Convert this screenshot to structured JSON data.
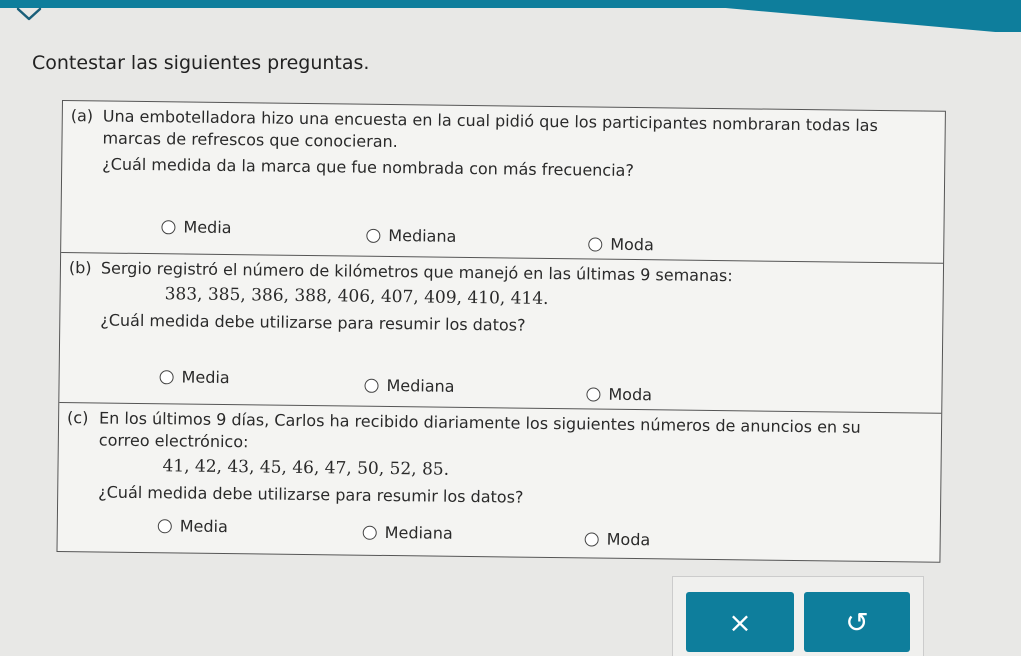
{
  "header": {
    "title": "Contestar las siguientes preguntas.",
    "expand_icon": "chevron-down-icon"
  },
  "questions": [
    {
      "letter": "(a)",
      "lines": [
        "Una embotelladora hizo una encuesta en la cual pidió que los participantes nombraran todas las",
        "marcas de refrescos que conocieran."
      ],
      "numbers": "",
      "ask": "¿Cuál medida da la marca que fue nombrada con más frecuencia?",
      "options": [
        "Media",
        "Mediana",
        "Moda"
      ]
    },
    {
      "letter": "(b)",
      "lines": [
        "Sergio registró el número de kilómetros que manejó en las últimas 9 semanas:"
      ],
      "numbers": "383, 385, 386, 388, 406, 407, 409, 410, 414.",
      "ask": "¿Cuál medida debe utilizarse para resumir los datos?",
      "options": [
        "Media",
        "Mediana",
        "Moda"
      ]
    },
    {
      "letter": "(c)",
      "lines": [
        "En los últimos 9 días, Carlos ha recibido diariamente los siguientes números de anuncios en su",
        "correo electrónico:"
      ],
      "numbers": "41, 42, 43, 45, 46, 47, 50, 52, 85.",
      "ask": "¿Cuál medida debe utilizarse para resumir los datos?",
      "options": [
        "Media",
        "Mediana",
        "Moda"
      ]
    }
  ],
  "buttons": {
    "clear_label": "×",
    "undo_label": "↺",
    "clear_icon": "close-icon",
    "undo_icon": "undo-icon"
  },
  "colors": {
    "accent": "#0e7e9c"
  }
}
